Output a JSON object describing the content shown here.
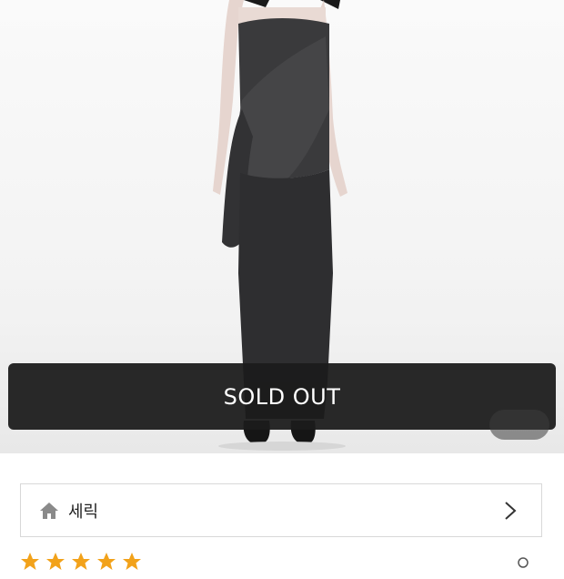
{
  "banner": {
    "status_label": "SOLD OUT"
  },
  "shop": {
    "name": "세릭"
  },
  "rating": {
    "stars": 5,
    "star_color": "#f2a21a"
  },
  "colors": {
    "banner_bg": "#1c1c1c",
    "accent": "#f2a21a"
  }
}
